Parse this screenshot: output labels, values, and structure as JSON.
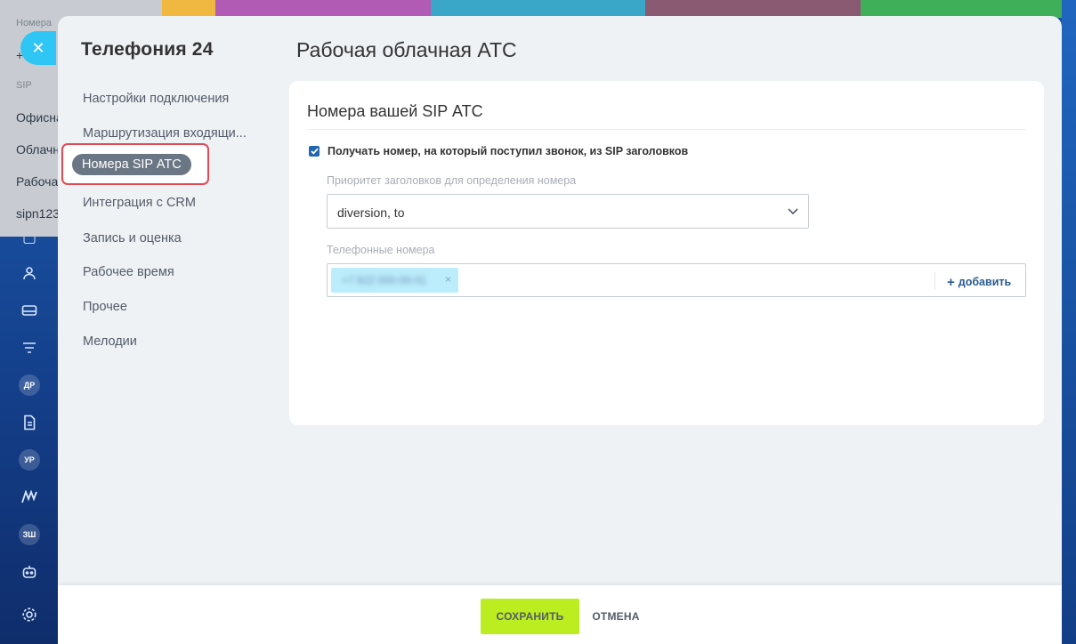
{
  "background": {
    "stripe_colors": [
      "#f0b840",
      "#b15bb5",
      "#3aa6c8",
      "#8a5a72",
      "#3faf5a"
    ],
    "panel": {
      "items": [
        {
          "label": "Номера",
          "small": true
        },
        {
          "label": "+",
          "small": false
        },
        {
          "label": "SIP",
          "small": true
        },
        {
          "label": "Офисна",
          "small": false
        },
        {
          "label": "Облачн",
          "small": false
        },
        {
          "label": "Рабоча",
          "small": false
        },
        {
          "label": "sipn123",
          "small": false
        }
      ]
    },
    "leftbar_badges": [
      "ДР",
      "УР",
      "ЗШ"
    ]
  },
  "sidebar": {
    "title": "Телефония 24",
    "items": [
      {
        "label": "Настройки подключения"
      },
      {
        "label": "Маршрутизация входящи..."
      },
      {
        "label": "Номера SIP АТС",
        "active": true
      },
      {
        "label": "Интеграция с CRM"
      },
      {
        "label": "Запись и оценка"
      },
      {
        "label": "Рабочее время"
      },
      {
        "label": "Прочее"
      },
      {
        "label": "Мелодии"
      }
    ]
  },
  "main": {
    "title": "Рабочая облачная АТС",
    "card": {
      "title": "Номера вашей SIP АТС",
      "checkbox_label": "Получать номер, на который поступил звонок, из SIP заголовков",
      "checkbox_checked": true,
      "priority_label": "Приоритет заголовков для определения номера",
      "priority_value": "diversion, to",
      "phones_label": "Телефонные номера",
      "phones": [
        "+7 922 000-00-01"
      ],
      "add_label": "добавить"
    }
  },
  "footer": {
    "save_label": "СОХРАНИТЬ",
    "cancel_label": "ОТМЕНА"
  },
  "colors": {
    "accent_green": "#bbed21",
    "active_outline": "#e04a55",
    "close_button": "#2fc6f6"
  }
}
